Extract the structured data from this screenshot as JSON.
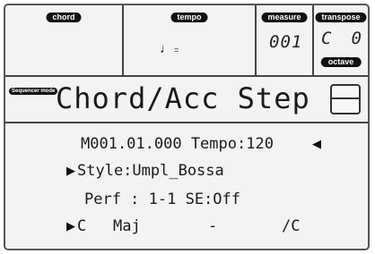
{
  "header": {
    "chord_label": "chord",
    "tempo_label": "tempo",
    "tempo_value": "♩",
    "tempo_eq": "=",
    "measure_label": "measure",
    "measure_value": "001",
    "transpose_label": "transpose",
    "transpose_left": "C",
    "transpose_right": "0",
    "octave_label": "octave"
  },
  "page": {
    "badge": "Sequencer mode",
    "title": "Chord/Acc Step"
  },
  "rows": {
    "position": "M001.01.000 Tempo:120",
    "position_arrow": "◀",
    "style_arrow": "▶",
    "style": "Style:Umpl_Bossa",
    "perf": "Perf : 1-1  SE:Off",
    "chord_arrow": "▶",
    "chord_root": "C",
    "chord_type": "Maj",
    "chord_dash": "-",
    "chord_bass": "/C"
  }
}
